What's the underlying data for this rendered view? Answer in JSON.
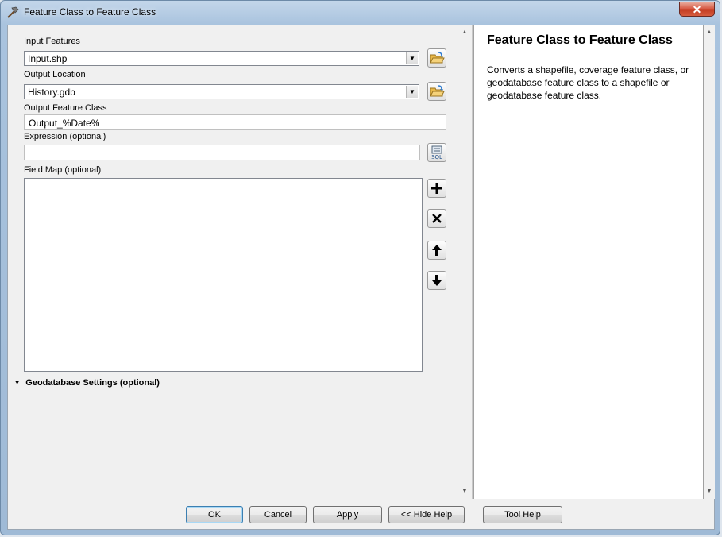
{
  "window": {
    "title": "Feature Class to Feature Class",
    "close_label": "✕"
  },
  "form": {
    "input_features_label": "Input Features",
    "input_features_value": "Input.shp",
    "output_location_label": "Output Location",
    "output_location_value": "History.gdb",
    "output_feature_class_label": "Output Feature Class",
    "output_feature_class_value": "Output_%Date%",
    "expression_label": "Expression (optional)",
    "expression_value": "",
    "field_map_label": "Field Map (optional)",
    "geodatabase_settings_label": "Geodatabase Settings (optional)"
  },
  "help": {
    "title": "Feature Class to Feature Class",
    "body": "Converts a shapefile, coverage feature class, or geodatabase feature class to a shapefile or geodatabase feature class."
  },
  "buttons": {
    "ok": "OK",
    "cancel": "Cancel",
    "apply": "Apply",
    "hide_help": "<< Hide Help",
    "tool_help": "Tool Help"
  },
  "icons": {
    "tool": "hammer-icon",
    "browse": "open-folder-icon",
    "sql": "sql-icon",
    "add": "plus-icon",
    "delete": "x-icon",
    "up": "arrow-up-icon",
    "down": "arrow-down-icon",
    "expand": "double-chevron-down-icon"
  },
  "colors": {
    "accent": "#3c7fb1",
    "close": "#c23a20"
  }
}
